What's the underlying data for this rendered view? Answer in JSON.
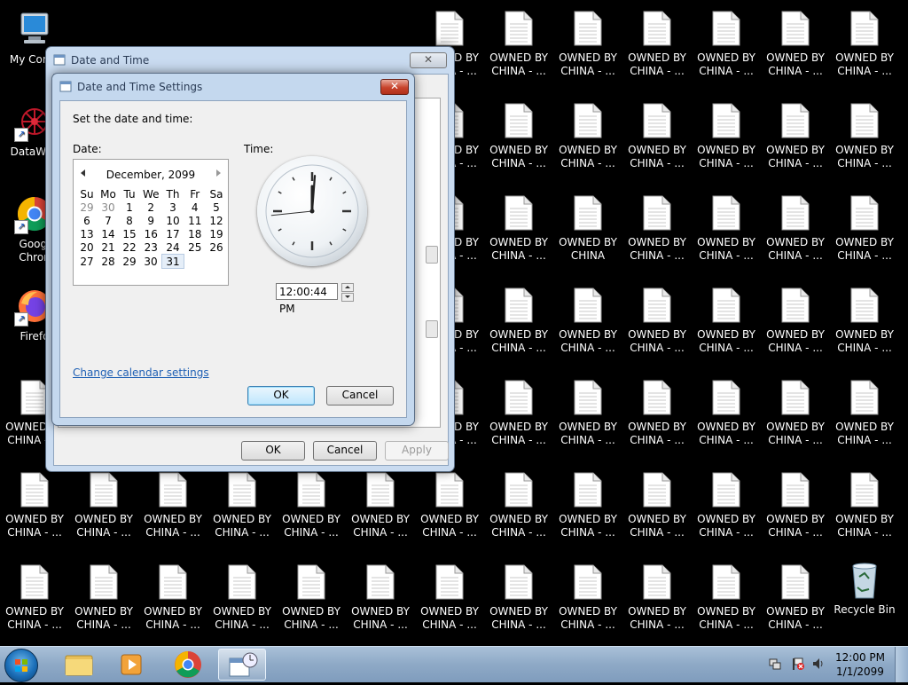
{
  "desktop": {
    "file_label": "OWNED BY\nCHINA - ...",
    "file_label_alt": "OWNED BY\nCHINA",
    "file_label_partial": "D BY\nA - ...",
    "icons": {
      "my_computer": "My Comp",
      "datawagon": "DataWag",
      "chrome": "Googl\nChron",
      "firefox": "Firefo",
      "recycle": "Recycle Bin"
    }
  },
  "outer_window": {
    "title": "Date and Time",
    "close": "✕",
    "buttons": {
      "ok": "OK",
      "cancel": "Cancel",
      "apply": "Apply"
    }
  },
  "inner_window": {
    "title": "Date and Time Settings",
    "close": "✕",
    "prompt": "Set the date and time:",
    "date_label": "Date:",
    "time_label": "Time:",
    "calendar": {
      "month_year": "December, 2099",
      "weekdays": [
        "Su",
        "Mo",
        "Tu",
        "We",
        "Th",
        "Fr",
        "Sa"
      ],
      "weeks": [
        [
          "29",
          "30",
          "1",
          "2",
          "3",
          "4",
          "5"
        ],
        [
          "6",
          "7",
          "8",
          "9",
          "10",
          "11",
          "12"
        ],
        [
          "13",
          "14",
          "15",
          "16",
          "17",
          "18",
          "19"
        ],
        [
          "20",
          "21",
          "22",
          "23",
          "24",
          "25",
          "26"
        ],
        [
          "27",
          "28",
          "29",
          "30",
          "31",
          "",
          ""
        ]
      ],
      "selected_day": "31"
    },
    "clock": {
      "hour": 12,
      "minute": 0,
      "second": 44
    },
    "time_value": "12:00:44 PM",
    "change_link": "Change calendar settings",
    "ok": "OK",
    "cancel": "Cancel"
  },
  "taskbar": {
    "clock_time": "12:00 PM",
    "clock_date": "1/1/2099"
  }
}
